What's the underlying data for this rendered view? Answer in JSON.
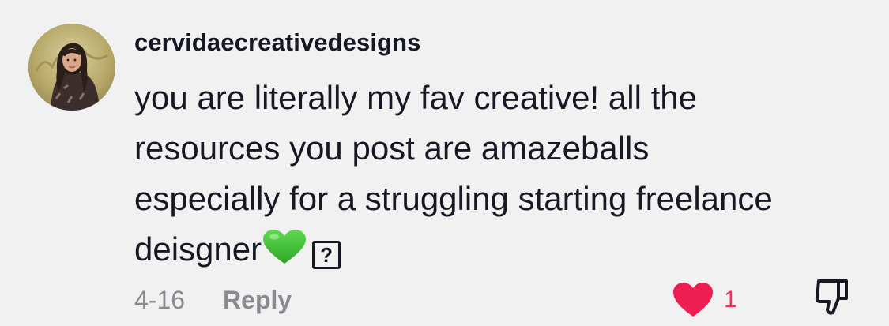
{
  "comment": {
    "username": "cervidaecreativedesigns",
    "text_lines": [
      "you are literally my fav creative! all the",
      "resources you post are amazeballs",
      "especially for a struggling starting freelance",
      "deisgner"
    ],
    "emoji": "green-heart",
    "missing_glyph": "?",
    "date": "4-16",
    "reply_label": "Reply",
    "like_count": "1",
    "icons": {
      "like": "heart-icon",
      "dislike": "thumbs-down-icon"
    },
    "colors": {
      "background": "#f1f1f2",
      "text": "#161823",
      "muted": "#8a8b91",
      "like": "#fe2c55",
      "emoji_heart": "#3fc23a"
    }
  }
}
